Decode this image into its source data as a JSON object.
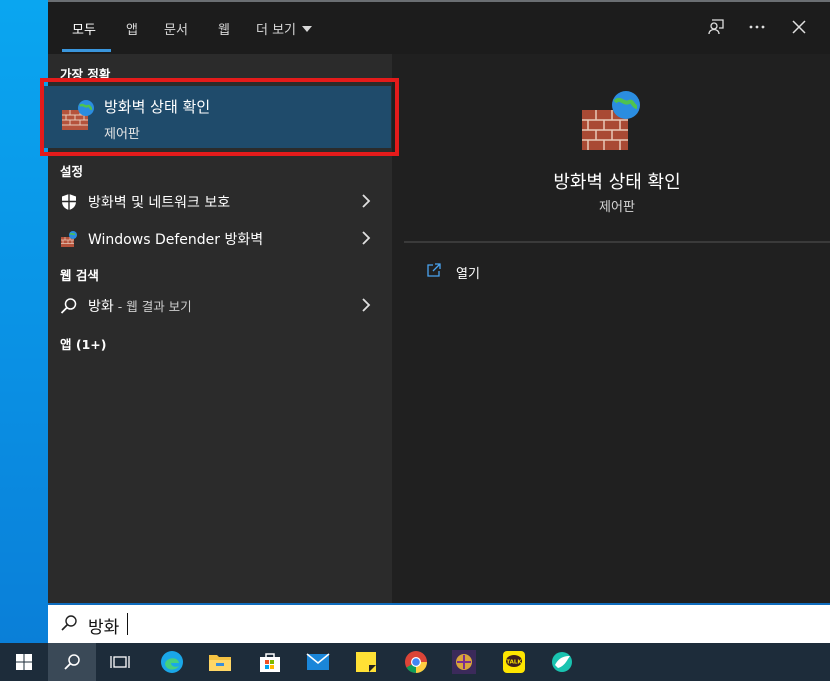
{
  "tabs": [
    {
      "label": "모두"
    },
    {
      "label": "앱"
    },
    {
      "label": "문서"
    },
    {
      "label": "웹"
    },
    {
      "label": "더 보기"
    }
  ],
  "left": {
    "best_match_header": "가장 정확",
    "best_match": {
      "title": "방화벽 상태 확인",
      "subtitle": "제어판"
    },
    "settings_header": "설정",
    "settings_items": [
      {
        "label": "방화벽 및 네트워크 보호"
      },
      {
        "label": "Windows Defender 방화벽"
      }
    ],
    "web_header": "웹 검색",
    "web_item": {
      "query": "방화",
      "suffix": " - 웹 결과 보기"
    },
    "apps_header": "앱 (1+)"
  },
  "preview": {
    "title": "방화벽 상태 확인",
    "subtitle": "제어판",
    "open_label": "열기"
  },
  "search": {
    "value": "방화"
  },
  "taskbar": {
    "icons": [
      "windows-start-icon",
      "search-icon",
      "task-view-icon",
      "edge-icon",
      "file-explorer-icon",
      "microsoft-store-icon",
      "mail-icon",
      "sticky-notes-icon",
      "chrome-icon",
      "game-app-icon",
      "kakaotalk-icon",
      "app-icon"
    ]
  },
  "colors": {
    "accent": "#3a96dd",
    "highlight": "#1f4b6b",
    "annotation": "#e41b1b",
    "panel": "#202020"
  }
}
